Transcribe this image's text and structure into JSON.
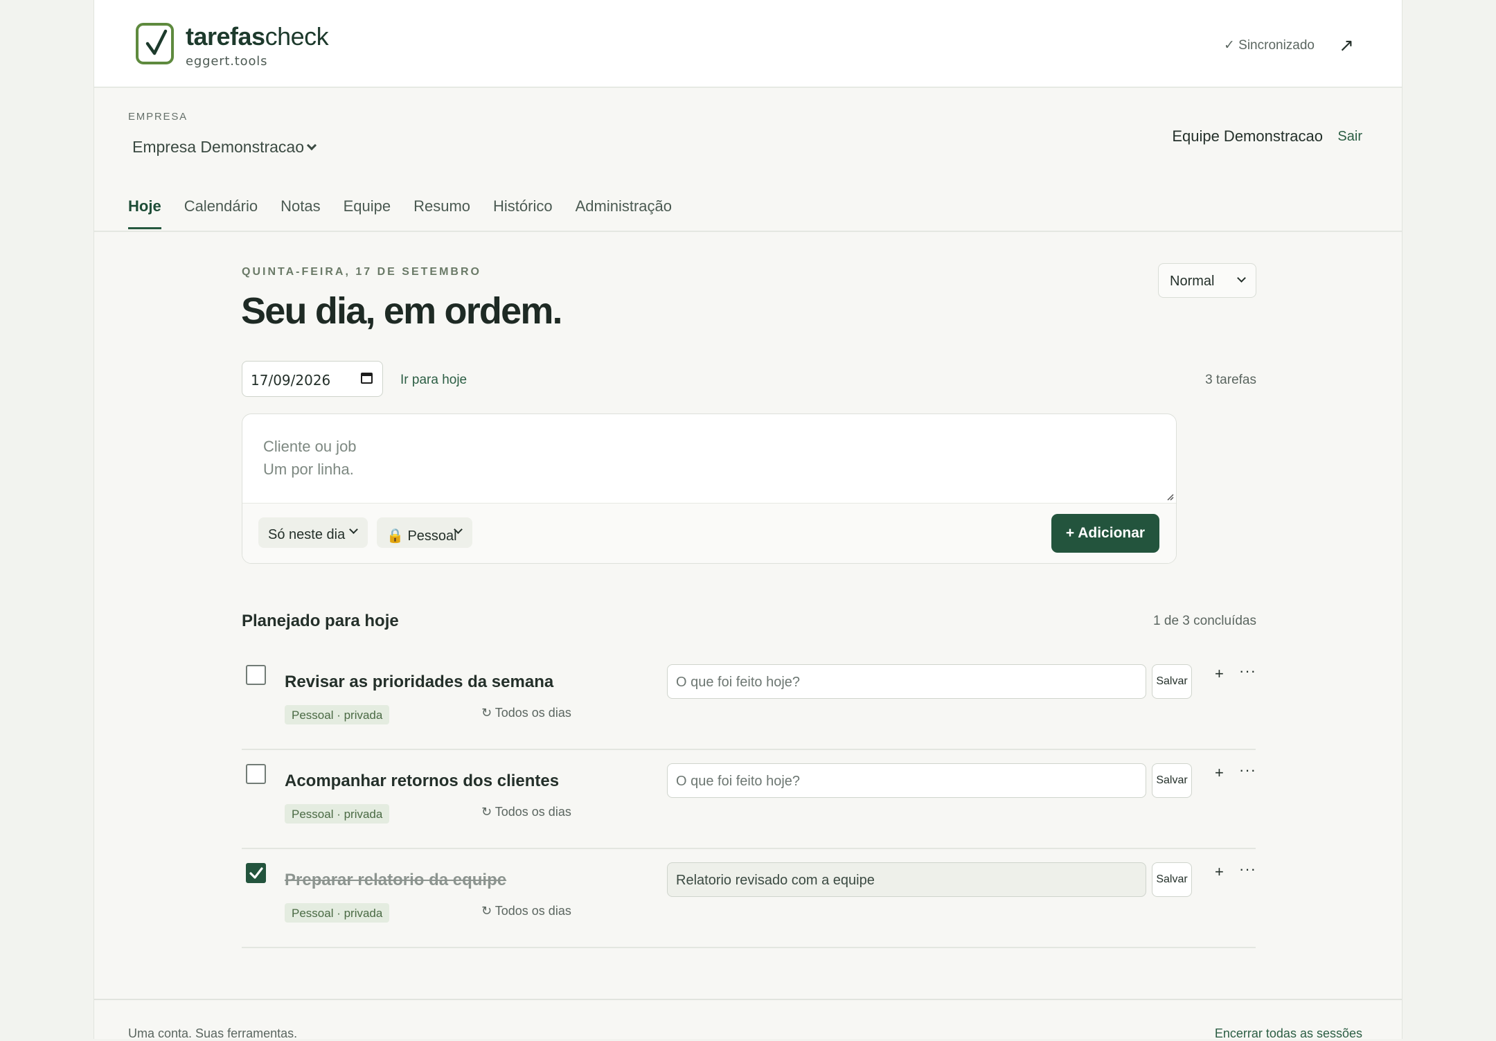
{
  "header": {
    "brand_bold": "tarefas",
    "brand_regular": "check",
    "brand_sub": "eggert.tools",
    "sync_status": "✓ Sincronizado",
    "external_link": "↗"
  },
  "company": {
    "label": "EMPRESA",
    "selected": "Empresa Demonstracao",
    "team": "Equipe Demonstracao",
    "logout": "Sair"
  },
  "tabs": [
    {
      "label": "Hoje",
      "active": true
    },
    {
      "label": "Calendário"
    },
    {
      "label": "Notas"
    },
    {
      "label": "Equipe"
    },
    {
      "label": "Resumo"
    },
    {
      "label": "Histórico"
    },
    {
      "label": "Administração"
    }
  ],
  "day": {
    "eyebrow": "QUINTA-FEIRA, 17 DE SETEMBRO",
    "headline": "Seu dia, em ordem.",
    "density": "Normal",
    "date_value": "17/09/2026",
    "go_today": "Ir para hoje",
    "task_count": "3 tarefas"
  },
  "composer": {
    "placeholder": "Cliente ou job\nUm por linha.",
    "recurrence": "Só neste dia",
    "visibility": "🔒 Pessoal",
    "add_label": "+ Adicionar"
  },
  "planned": {
    "title": "Planejado para hoje",
    "progress": "1 de 3 concluídas",
    "tasks": [
      {
        "title": "Revisar as prioridades da semana",
        "done": false,
        "tag": "Pessoal · privada",
        "repeat": "↻ Todos os dias",
        "note": "",
        "note_placeholder": "O que foi feito hoje?",
        "save": "Salvar",
        "plus": "+",
        "more": "···"
      },
      {
        "title": "Acompanhar retornos dos clientes",
        "done": false,
        "tag": "Pessoal · privada",
        "repeat": "↻ Todos os dias",
        "note": "",
        "note_placeholder": "O que foi feito hoje?",
        "save": "Salvar",
        "plus": "+",
        "more": "···"
      },
      {
        "title": "Preparar relatorio da equipe",
        "done": true,
        "tag": "Pessoal · privada",
        "repeat": "↻ Todos os dias",
        "note": "Relatorio revisado com a equipe",
        "note_placeholder": "",
        "save": "Salvar",
        "plus": "+",
        "more": "···"
      }
    ]
  },
  "footer": {
    "left": "Uma conta. Suas ferramentas.",
    "right": "Encerrar todas as sessões"
  },
  "colors": {
    "accent": "#23543d",
    "tag_bg": "#e4ece0",
    "logo_green": "#5e8a3e"
  }
}
